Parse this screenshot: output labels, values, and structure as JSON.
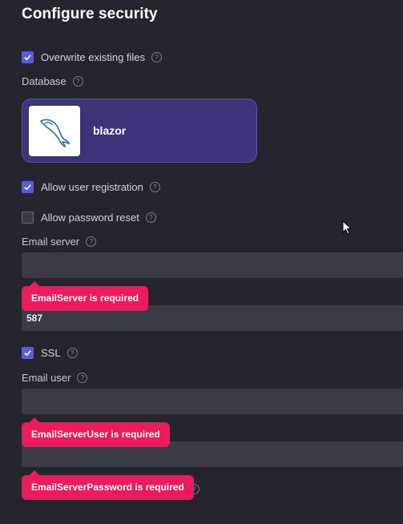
{
  "title": "Configure security",
  "overwrite": {
    "label": "Overwrite existing files",
    "checked": true
  },
  "database": {
    "label": "Database",
    "selected": {
      "name": "blazor",
      "icon": "mysql-dolphin-icon"
    }
  },
  "allow_registration": {
    "label": "Allow user registration",
    "checked": true
  },
  "allow_password_reset": {
    "label": "Allow password reset",
    "checked": false
  },
  "email_server": {
    "label": "Email server",
    "value": "",
    "error": "EmailServer is required"
  },
  "email_port": {
    "value": "587"
  },
  "ssl": {
    "label": "SSL",
    "checked": true
  },
  "email_user": {
    "label": "Email user",
    "value": "",
    "error": "EmailServerUser is required"
  },
  "email_password": {
    "value": "",
    "error": "EmailServerPassword is required"
  },
  "colors": {
    "background": "#25252d",
    "accent": "#5b58e8",
    "card": "#3a3578",
    "input": "#3b3b45",
    "error": "#f0195e"
  }
}
